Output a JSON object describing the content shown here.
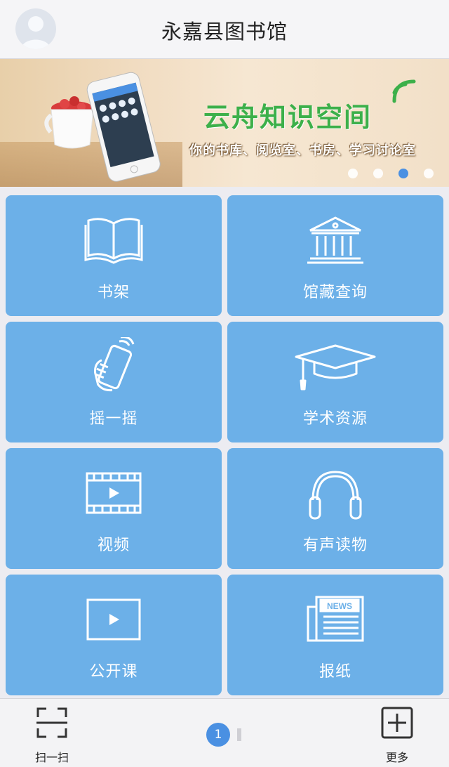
{
  "header": {
    "title": "永嘉县图书馆"
  },
  "banner": {
    "title": "云舟知识空间",
    "subtitle": "你的书库、阅览室、书房、学习讨论室",
    "active_dot": 2,
    "dot_count": 4
  },
  "tiles": [
    {
      "label": "书架",
      "icon": "book-icon"
    },
    {
      "label": "馆藏查询",
      "icon": "library-building-icon"
    },
    {
      "label": "摇一摇",
      "icon": "shake-phone-icon"
    },
    {
      "label": "学术资源",
      "icon": "graduation-cap-icon"
    },
    {
      "label": "视频",
      "icon": "video-icon"
    },
    {
      "label": "有声读物",
      "icon": "headphones-icon"
    },
    {
      "label": "公开课",
      "icon": "play-screen-icon"
    },
    {
      "label": "报纸",
      "icon": "newspaper-icon"
    }
  ],
  "newspaper_icon_text": "NEWS",
  "footer": {
    "scan_label": "扫一扫",
    "more_label": "更多",
    "page_number": "1"
  },
  "colors": {
    "tile": "#6cb0e8",
    "accent": "#4a90e2",
    "banner_title": "#3cb04a"
  }
}
